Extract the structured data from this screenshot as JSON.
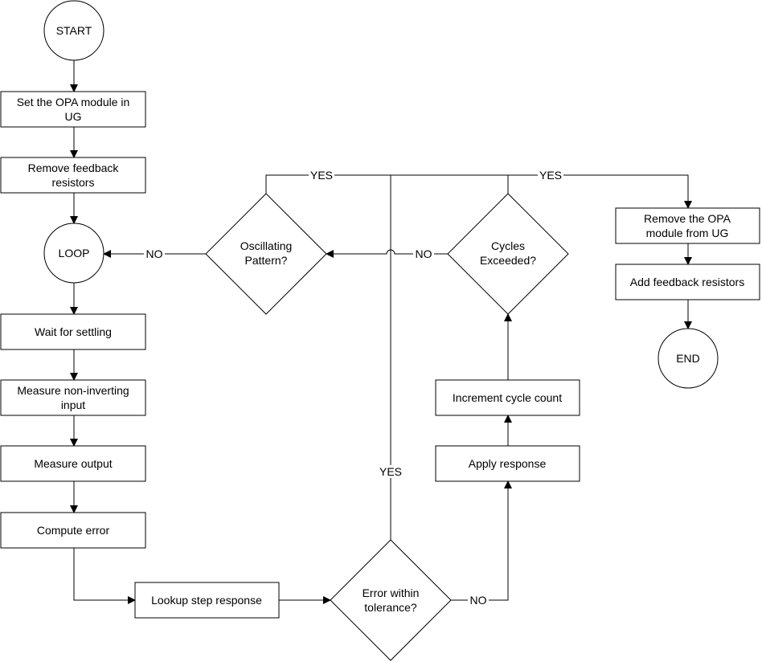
{
  "nodes": {
    "start": "START",
    "set_opa": [
      "Set the OPA module in",
      "UG"
    ],
    "remove_feedback": [
      "Remove feedback",
      "resistors"
    ],
    "loop": "LOOP",
    "wait": "Wait for settling",
    "measure_ninv": [
      "Measure non-inverting",
      "input"
    ],
    "measure_output": "Measure output",
    "compute_error": "Compute error",
    "lookup": "Lookup step response",
    "error_tol": [
      "Error within",
      "tolerance?"
    ],
    "apply": "Apply response",
    "increment": "Increment cycle count",
    "cycles": [
      "Cycles",
      "Exceeded?"
    ],
    "oscillating": [
      "Oscillating",
      "Pattern?"
    ],
    "remove_opa": [
      "Remove the OPA",
      "module from UG"
    ],
    "add_feedback": "Add feedback resistors",
    "end": "END"
  },
  "edge_labels": {
    "osc_yes": "YES",
    "cycles_yes": "YES",
    "error_yes": "YES",
    "cycles_no": "NO",
    "osc_no": "NO",
    "error_no": "NO"
  }
}
